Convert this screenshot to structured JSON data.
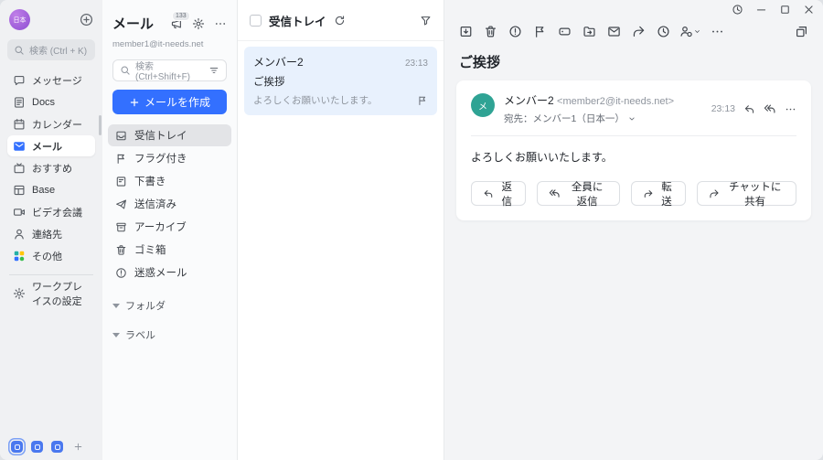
{
  "window": {
    "controls": [
      "history",
      "minimize",
      "maximize",
      "close"
    ]
  },
  "app_sidebar": {
    "avatar_text": "日本",
    "search_placeholder": "検索 (Ctrl + K)",
    "items": [
      {
        "label": "メッセージ",
        "icon": "chat-icon"
      },
      {
        "label": "Docs",
        "icon": "docs-icon"
      },
      {
        "label": "カレンダー",
        "icon": "calendar-icon"
      },
      {
        "label": "メール",
        "icon": "mail-icon",
        "active": true
      },
      {
        "label": "おすすめ",
        "icon": "feed-icon"
      },
      {
        "label": "Base",
        "icon": "base-icon"
      },
      {
        "label": "ビデオ会議",
        "icon": "video-icon"
      },
      {
        "label": "連絡先",
        "icon": "contacts-icon"
      },
      {
        "label": "その他",
        "icon": "more-apps-icon"
      }
    ],
    "settings_label": "ワークプレイスの設定",
    "dock_windows": 3
  },
  "mail_nav": {
    "title": "メール",
    "migration_badge": "133",
    "account": "member1@it-needs.net",
    "search_placeholder": "検索 (Ctrl+Shift+F)",
    "compose_label": "メールを作成",
    "folders": [
      {
        "label": "受信トレイ",
        "icon": "inbox-icon",
        "active": true
      },
      {
        "label": "フラグ付き",
        "icon": "flag-icon"
      },
      {
        "label": "下書き",
        "icon": "draft-icon"
      },
      {
        "label": "送信済み",
        "icon": "sent-icon"
      },
      {
        "label": "アーカイブ",
        "icon": "archive-icon"
      },
      {
        "label": "ゴミ箱",
        "icon": "trash-icon"
      },
      {
        "label": "迷惑メール",
        "icon": "spam-icon"
      }
    ],
    "sections": [
      {
        "label": "フォルダ"
      },
      {
        "label": "ラベル"
      }
    ]
  },
  "mail_list": {
    "header": "受信トレイ",
    "item": {
      "sender": "メンバー2",
      "time": "23:13",
      "subject": "ご挨拶",
      "preview": "よろしくお願いいたします。",
      "flagged": false
    }
  },
  "reading_pane": {
    "toolbar_icons": [
      "archive",
      "delete",
      "report-spam",
      "flag",
      "label",
      "move-to-folder",
      "mark-as-read",
      "forward",
      "snooze",
      "assign",
      "more",
      "open-in-new-window"
    ],
    "subject": "ご挨拶",
    "message": {
      "avatar_text": "メ",
      "sender": "メンバー2",
      "sender_email": "<member2@it-needs.net>",
      "to_label": "宛先：メンバー1（日本一）",
      "time": "23:13",
      "body": "よろしくお願いいたします。",
      "actions": [
        {
          "label": "返信",
          "icon": "reply-icon"
        },
        {
          "label": "全員に返信",
          "icon": "reply-all-icon"
        },
        {
          "label": "転送",
          "icon": "forward-icon"
        },
        {
          "label": "チャットに共有",
          "icon": "share-to-chat-icon"
        }
      ]
    }
  },
  "colors": {
    "accent": "#3370ff",
    "selected_mail_bg": "#e8f1fd",
    "tenant_avatar": "#9d5dd8",
    "sender_avatar": "#2fa394",
    "sidebar_bg": "#f0f1f3"
  }
}
